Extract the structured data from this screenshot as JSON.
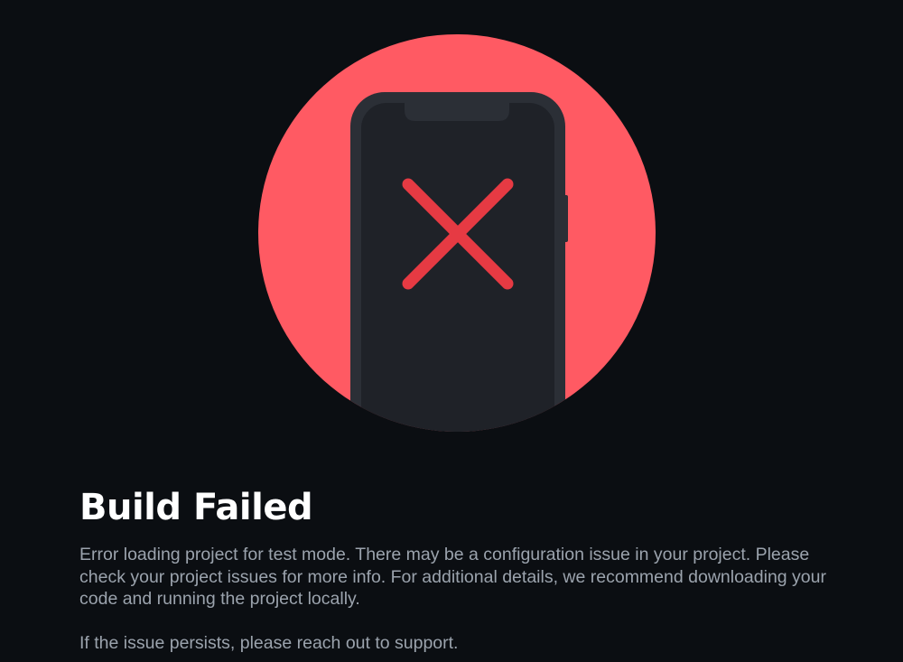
{
  "error_page": {
    "title": "Build Failed",
    "message": "Error loading project for test mode. There may be a configuration issue in your project. Please check your project issues for more info. For additional details, we recommend downloading your code and running the project locally.",
    "support_message": "If the issue persists, please reach out to support."
  },
  "illustration": {
    "icon": "phone-error-icon",
    "circle_color": "#ff5a63",
    "phone_color": "#22252b",
    "cross_color": "#e63a43"
  },
  "colors": {
    "background": "#0b0e12",
    "title": "#ffffff",
    "body_text": "#9ba3ad"
  }
}
